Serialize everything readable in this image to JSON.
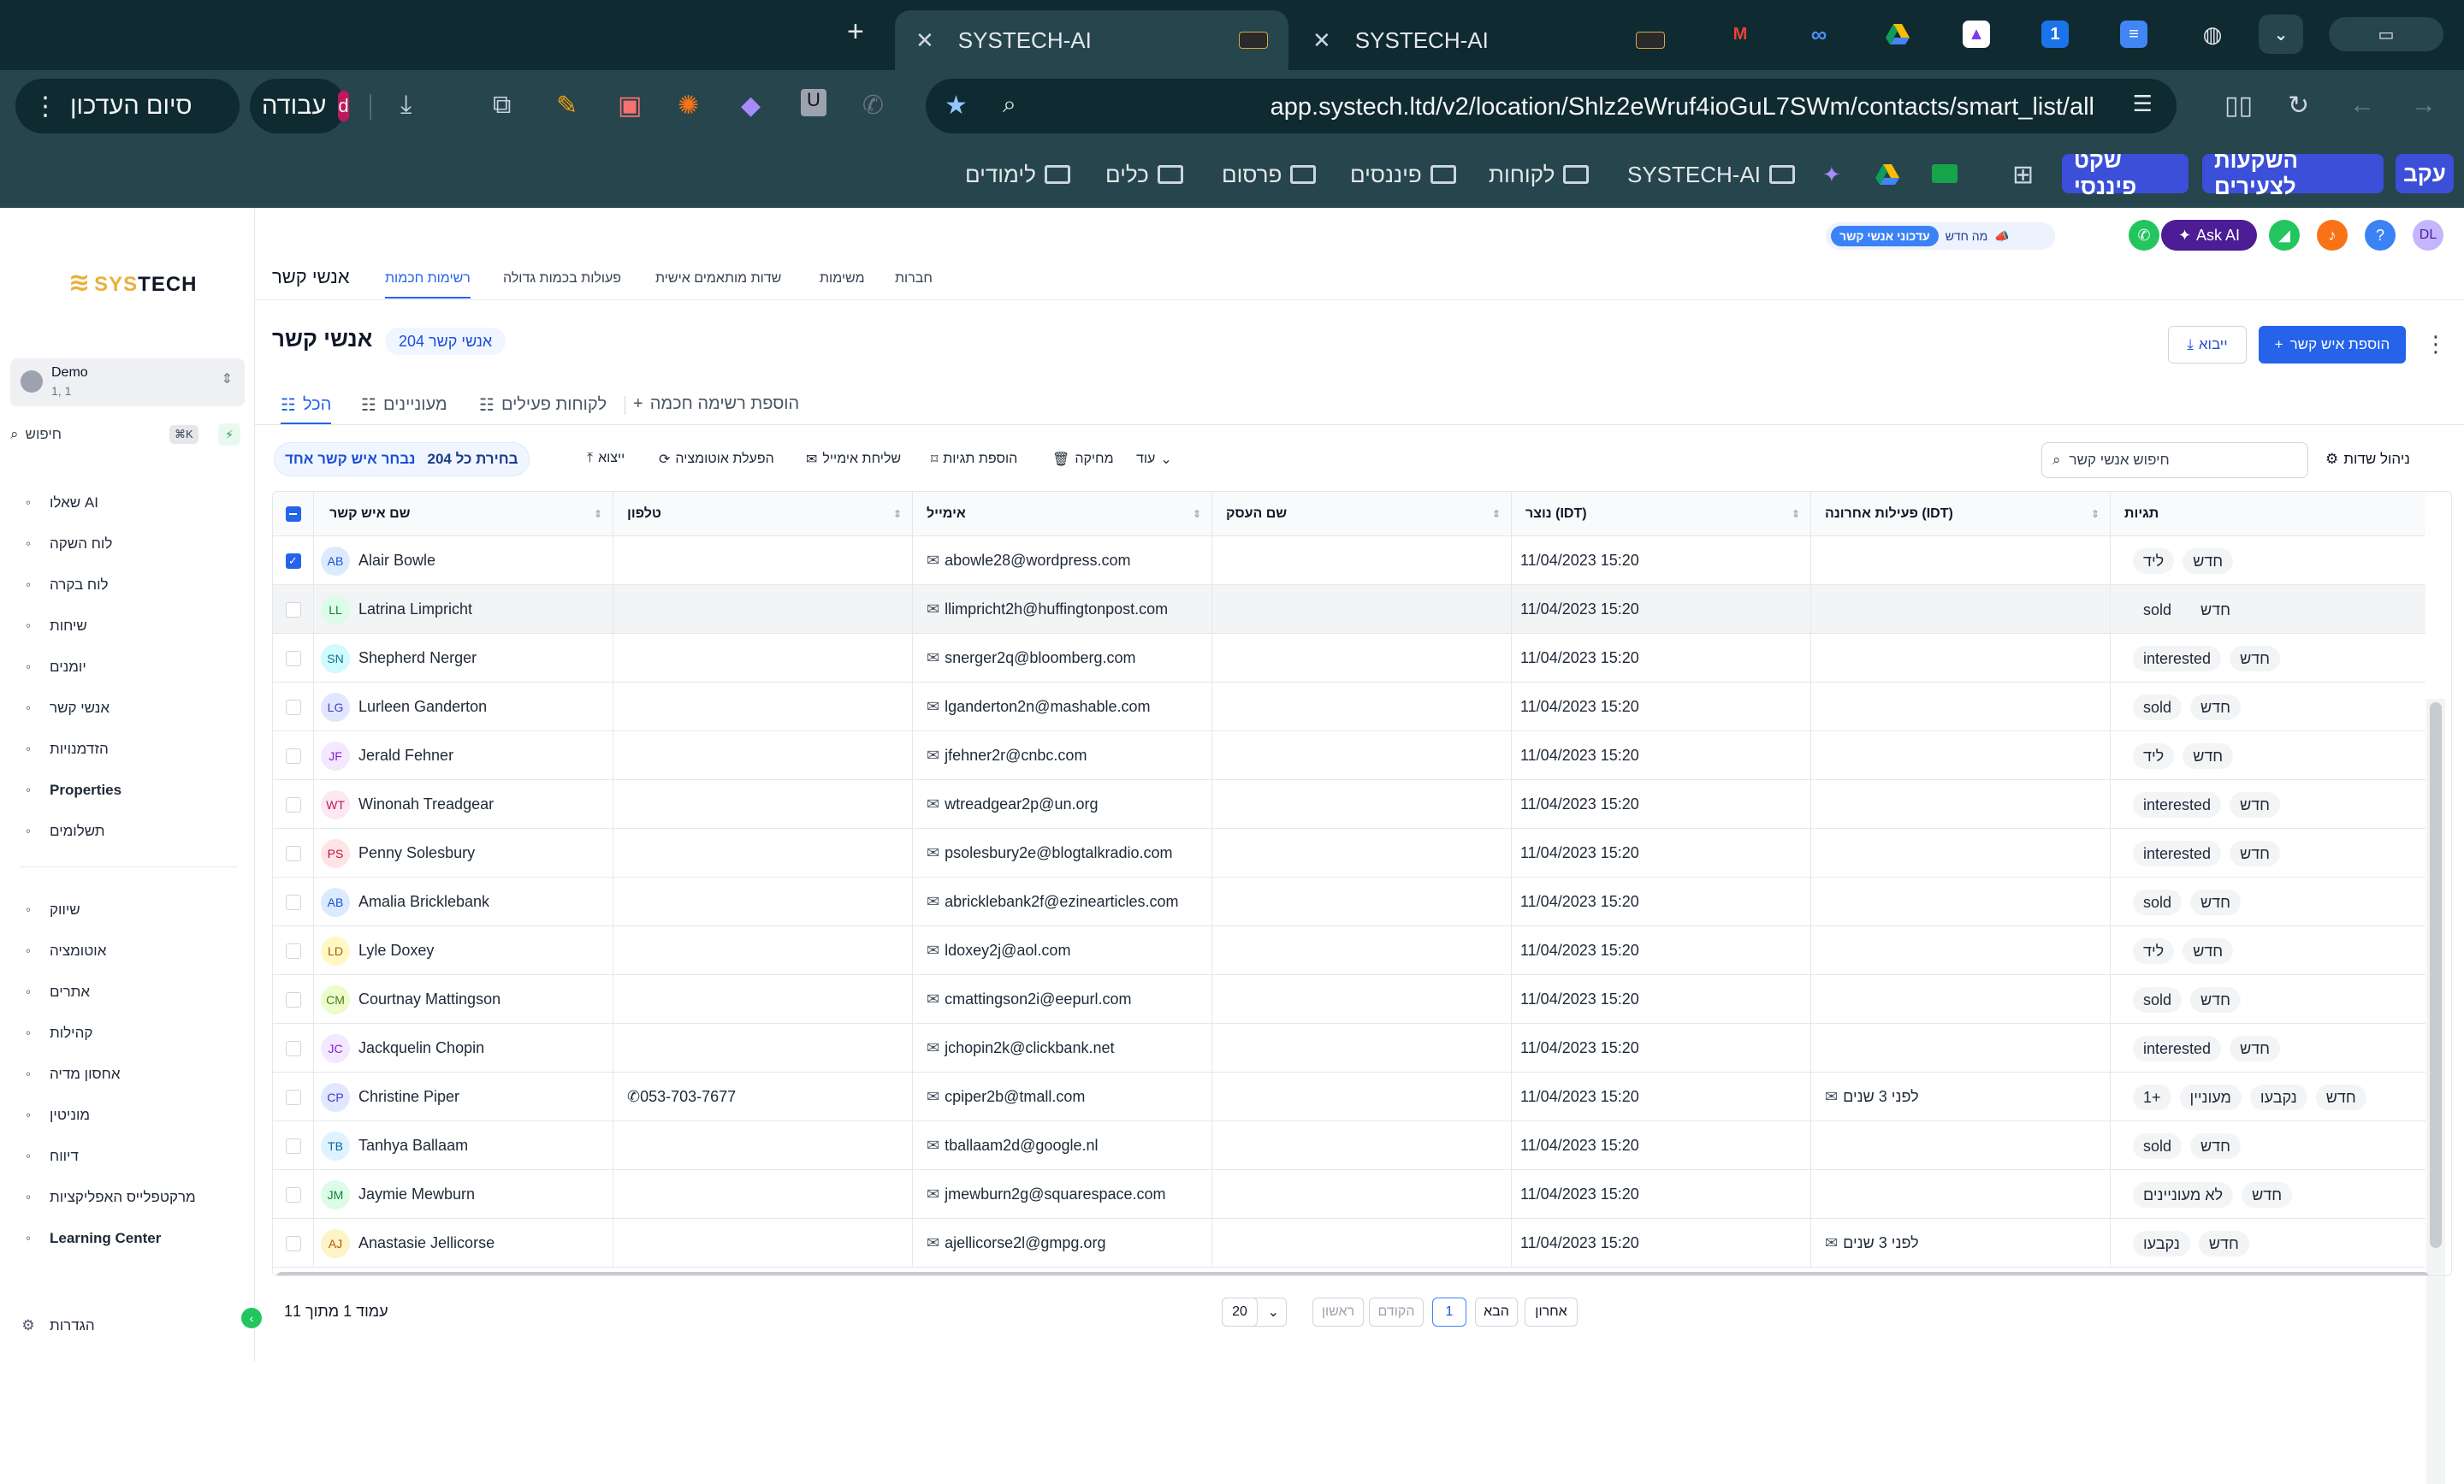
{
  "browser": {
    "tabs": [
      {
        "title": "SYSTECH-AI"
      },
      {
        "title": "SYSTECH-AI"
      }
    ],
    "url": "app.systech.ltd/v2/location/Shlz2eWruf4ioGuL7SWm/contacts/smart_list/all",
    "profile_label": "עבודה",
    "profile_initial": "d",
    "finish_update": "סיום העדכון",
    "bookmarks": [
      "עקב",
      "השקעות לצעירים",
      "שקט פיננסי",
      "SYSTECH-AI",
      "לקוחות",
      "פיננסים",
      "פרסום",
      "כלים",
      "לימודים"
    ],
    "toolbar_icons": [
      "gmail-icon",
      "meta-icon",
      "drive-icon",
      "clickup-icon",
      "onepassword-icon",
      "docs-icon",
      "globe-icon"
    ]
  },
  "sidebar": {
    "logo_text_a": "SYS",
    "logo_text_b": "TECH",
    "account_name": "Demo",
    "account_sub": "1, 1",
    "search_placeholder": "חיפוש",
    "search_shortcut": "⌘K",
    "items": [
      {
        "label": "שאלו AI",
        "icon": "sparkle-icon"
      },
      {
        "label": "לוח השקה",
        "icon": "rocket-icon"
      },
      {
        "label": "לוח בקרה",
        "icon": "dashboard-icon"
      },
      {
        "label": "שיחות",
        "icon": "chat-icon"
      },
      {
        "label": "יומנים",
        "icon": "calendar-icon"
      },
      {
        "label": "אנשי קשר",
        "icon": "contacts-icon"
      },
      {
        "label": "הזדמנויות",
        "icon": "opportunities-icon"
      },
      {
        "label": "Properties",
        "icon": "building-icon"
      },
      {
        "label": "תשלומים",
        "icon": "payments-icon"
      }
    ],
    "items2": [
      {
        "label": "שיווק",
        "icon": "send-icon"
      },
      {
        "label": "אוטומציה",
        "icon": "automation-icon"
      },
      {
        "label": "אתרים",
        "icon": "sites-icon"
      },
      {
        "label": "קהילות",
        "icon": "communities-icon"
      },
      {
        "label": "אחסון מדיה",
        "icon": "media-icon"
      },
      {
        "label": "מוניטין",
        "icon": "star-icon"
      },
      {
        "label": "דיווח",
        "icon": "chart-line-icon"
      },
      {
        "label": "מרקטפלייס האפליקציות",
        "icon": "apps-icon"
      },
      {
        "label": "Learning Center",
        "icon": "graduation-icon"
      }
    ],
    "settings": "הגדרות"
  },
  "topbar": {
    "avatar_initials": "DL",
    "ask_ai": "Ask AI",
    "whats_new": "מה חדש",
    "updates_tag": "עדכוני אנשי קשר"
  },
  "tabs": {
    "page": "אנשי קשר",
    "items": [
      "רשימות חכמות",
      "פעולות בכמות גדולה",
      "שדות מותאמים אישית",
      "משימות",
      "חברות"
    ]
  },
  "header": {
    "title": "אנשי קשר",
    "count": "204 אנשי קשר",
    "add_contact": "הוספת איש קשר",
    "import": "ייבוא"
  },
  "subtabs": {
    "all": "הכל",
    "interested": "מעוניינים",
    "active_clients": "לקוחות פעילים",
    "add_smart_list": "הוספת רשימה חכמה"
  },
  "toolbar": {
    "selected": "נבחר איש קשר אחד",
    "select_all": "בחירת כל 204",
    "export": "ייצוא",
    "automation": "הפעלת אוטומציה",
    "send_email": "שליחת אימייל",
    "add_tags": "הוספת תגיות",
    "delete": "מחיקה",
    "more": "עוד",
    "search_placeholder": "חיפוש אנשי קשר",
    "manage_fields": "ניהול שדות"
  },
  "columns": {
    "name": "שם איש קשר",
    "phone": "טלפון",
    "email": "אימייל",
    "business": "שם העסק",
    "created": "נוצר (IDT)",
    "last_activity": "פעילות אחרונה (IDT)",
    "tags": "תגיות"
  },
  "rows": [
    {
      "initials": "AB",
      "name": "Alair Bowle",
      "phone": "",
      "email": "abowle28@wordpress.com",
      "created": "11/04/2023 15:20",
      "activity": "",
      "tags": [
        "חדש",
        "ליד"
      ],
      "checked": true,
      "color": "#dbeafe",
      "tcolor": "#1d4ed8"
    },
    {
      "initials": "LL",
      "name": "Latrina Limpricht",
      "phone": "",
      "email": "llimpricht2h@huffingtonpost.com",
      "created": "11/04/2023 15:20",
      "activity": "",
      "tags": [
        "חדש",
        "sold"
      ],
      "checked": false,
      "color": "#dcfce7",
      "tcolor": "#15803d"
    },
    {
      "initials": "SN",
      "name": "Shepherd Nerger",
      "phone": "",
      "email": "snerger2q@bloomberg.com",
      "created": "11/04/2023 15:20",
      "activity": "",
      "tags": [
        "חדש",
        "interested"
      ],
      "checked": false,
      "color": "#cffafe",
      "tcolor": "#0e7490"
    },
    {
      "initials": "LG",
      "name": "Lurleen Ganderton",
      "phone": "",
      "email": "lganderton2n@mashable.com",
      "created": "11/04/2023 15:20",
      "activity": "",
      "tags": [
        "חדש",
        "sold"
      ],
      "checked": false,
      "color": "#e0e7ff",
      "tcolor": "#4338ca"
    },
    {
      "initials": "JF",
      "name": "Jerald Fehner",
      "phone": "",
      "email": "jfehner2r@cnbc.com",
      "created": "11/04/2023 15:20",
      "activity": "",
      "tags": [
        "חדש",
        "ליד"
      ],
      "checked": false,
      "color": "#f3e8ff",
      "tcolor": "#7e22ce"
    },
    {
      "initials": "WT",
      "name": "Winonah Treadgear",
      "phone": "",
      "email": "wtreadgear2p@un.org",
      "created": "11/04/2023 15:20",
      "activity": "",
      "tags": [
        "חדש",
        "interested"
      ],
      "checked": false,
      "color": "#fce7f3",
      "tcolor": "#be185d"
    },
    {
      "initials": "PS",
      "name": "Penny Solesbury",
      "phone": "",
      "email": "psolesbury2e@blogtalkradio.com",
      "created": "11/04/2023 15:20",
      "activity": "",
      "tags": [
        "חדש",
        "interested"
      ],
      "checked": false,
      "color": "#ffe4e6",
      "tcolor": "#be123c"
    },
    {
      "initials": "AB",
      "name": "Amalia Bricklebank",
      "phone": "",
      "email": "abricklebank2f@ezinearticles.com",
      "created": "11/04/2023 15:20",
      "activity": "",
      "tags": [
        "חדש",
        "sold"
      ],
      "checked": false,
      "color": "#dbeafe",
      "tcolor": "#1d4ed8"
    },
    {
      "initials": "LD",
      "name": "Lyle Doxey",
      "phone": "",
      "email": "ldoxey2j@aol.com",
      "created": "11/04/2023 15:20",
      "activity": "",
      "tags": [
        "חדש",
        "ליד"
      ],
      "checked": false,
      "color": "#fef9c3",
      "tcolor": "#a16207"
    },
    {
      "initials": "CM",
      "name": "Courtnay Mattingson",
      "phone": "",
      "email": "cmattingson2i@eepurl.com",
      "created": "11/04/2023 15:20",
      "activity": "",
      "tags": [
        "חדש",
        "sold"
      ],
      "checked": false,
      "color": "#ecfccb",
      "tcolor": "#4d7c0f"
    },
    {
      "initials": "JC",
      "name": "Jackquelin Chopin",
      "phone": "",
      "email": "jchopin2k@clickbank.net",
      "created": "11/04/2023 15:20",
      "activity": "",
      "tags": [
        "חדש",
        "interested"
      ],
      "checked": false,
      "color": "#f3e8ff",
      "tcolor": "#7e22ce"
    },
    {
      "initials": "CP",
      "name": "Christine Piper",
      "phone": "053-703-7677",
      "email": "cpiper2b@tmall.com",
      "created": "11/04/2023 15:20",
      "activity": "לפני 3 שנים",
      "tags": [
        "חדש",
        "נקבעו",
        "מעוניין",
        "+1"
      ],
      "checked": false,
      "color": "#e0e7ff",
      "tcolor": "#4338ca"
    },
    {
      "initials": "TB",
      "name": "Tanhya Ballaam",
      "phone": "",
      "email": "tballaam2d@google.nl",
      "created": "11/04/2023 15:20",
      "activity": "",
      "tags": [
        "חדש",
        "sold"
      ],
      "checked": false,
      "color": "#e0f2fe",
      "tcolor": "#0369a1"
    },
    {
      "initials": "JM",
      "name": "Jaymie Mewburn",
      "phone": "",
      "email": "jmewburn2g@squarespace.com",
      "created": "11/04/2023 15:20",
      "activity": "",
      "tags": [
        "חדש",
        "לא מעוניינים"
      ],
      "checked": false,
      "color": "#dcfce7",
      "tcolor": "#15803d"
    },
    {
      "initials": "AJ",
      "name": "Anastasie Jellicorse",
      "phone": "",
      "email": "ajellicorse2l@gmpg.org",
      "created": "11/04/2023 15:20",
      "activity": "לפני 3 שנים",
      "tags": [
        "חדש",
        "נקבעו"
      ],
      "checked": false,
      "color": "#fef3c7",
      "tcolor": "#b45309"
    }
  ],
  "footer": {
    "page_info": "עמוד 1 מתוך 11",
    "page_size": "20",
    "first": "ראשון",
    "prev": "הקודם",
    "current": "1",
    "next": "הבא",
    "last": "אחרון"
  }
}
